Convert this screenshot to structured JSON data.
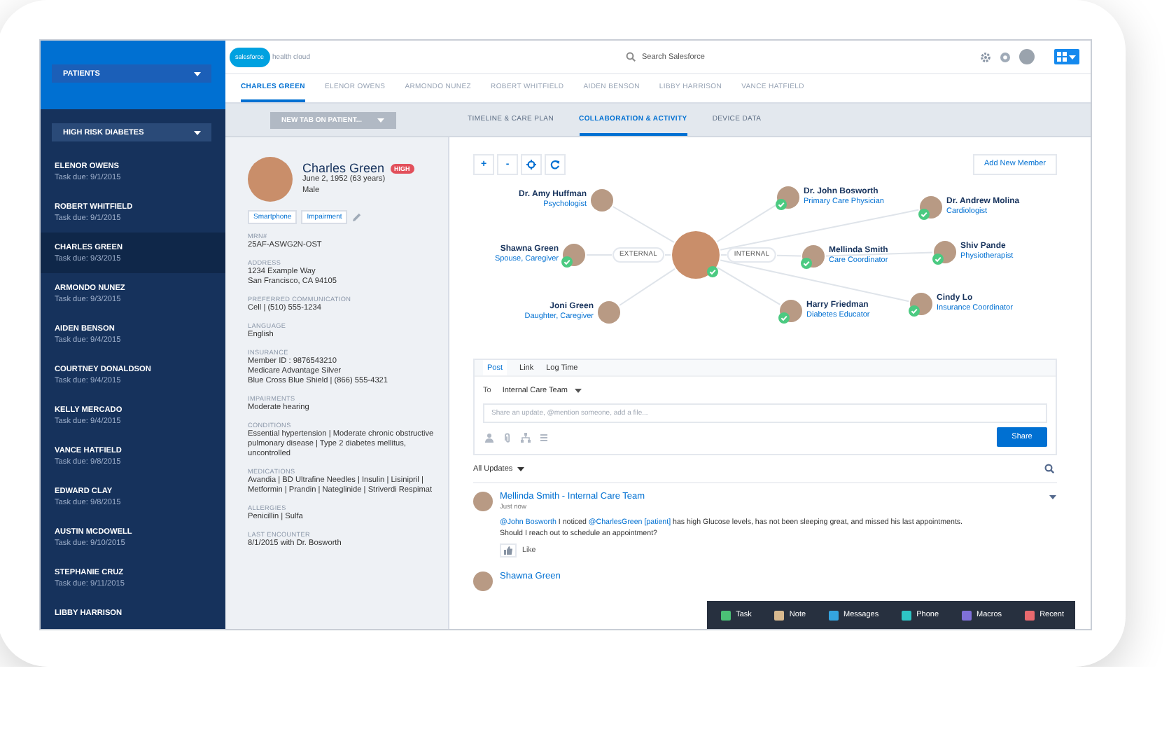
{
  "sidebar": {
    "list_selector": {
      "label": "PATIENTS"
    },
    "filter": {
      "label": "HIGH RISK DIABETES"
    },
    "patients": [
      {
        "name": "ELENOR OWENS",
        "task": "Task due: 9/1/2015",
        "selected": false
      },
      {
        "name": "ROBERT WHITFIELD",
        "task": "Task due: 9/1/2015",
        "selected": false
      },
      {
        "name": "CHARLES GREEN",
        "task": "Task due: 9/3/2015",
        "selected": true
      },
      {
        "name": "ARMONDO NUNEZ",
        "task": "Task due: 9/3/2015",
        "selected": false
      },
      {
        "name": "AIDEN BENSON",
        "task": "Task due: 9/4/2015",
        "selected": false
      },
      {
        "name": "COURTNEY DONALDSON",
        "task": "Task due: 9/4/2015",
        "selected": false
      },
      {
        "name": "KELLY MERCADO",
        "task": "Task due: 9/4/2015",
        "selected": false
      },
      {
        "name": "VANCE HATFIELD",
        "task": "Task due: 9/8/2015",
        "selected": false
      },
      {
        "name": "EDWARD CLAY",
        "task": "Task due: 9/8/2015",
        "selected": false
      },
      {
        "name": "AUSTIN MCDOWELL",
        "task": "Task due: 9/10/2015",
        "selected": false
      },
      {
        "name": "STEPHANIE CRUZ",
        "task": "Task due: 9/11/2015",
        "selected": false
      },
      {
        "name": "LIBBY HARRISON",
        "selected": false
      }
    ]
  },
  "header": {
    "logo": "salesforce",
    "app_name": "health cloud",
    "search": {
      "placeholder": "Search Salesforce"
    }
  },
  "patient_tabs": [
    {
      "label": "CHARLES GREEN",
      "selected": true
    },
    {
      "label": "ELENOR OWENS",
      "selected": false
    },
    {
      "label": "ARMONDO NUNEZ",
      "selected": false
    },
    {
      "label": "ROBERT WHITFIELD",
      "selected": false
    },
    {
      "label": "AIDEN BENSON",
      "selected": false
    },
    {
      "label": "LIBBY HARRISON",
      "selected": false
    },
    {
      "label": "VANCE HATFIELD",
      "selected": false
    }
  ],
  "new_tab": {
    "label": "NEW TAB ON PATIENT..."
  },
  "view_tabs": [
    {
      "label": "TIMELINE & CARE PLAN",
      "selected": false
    },
    {
      "label": "COLLABORATION & ACTIVITY",
      "selected": true
    },
    {
      "label": "DEVICE DATA",
      "selected": false
    }
  ],
  "patient": {
    "name": "Charles Green",
    "risk": "HIGH",
    "birth": "June 2, 1952 (63 years)",
    "gender": "Male",
    "tags": [
      "Smartphone",
      "Impairment"
    ],
    "fields": [
      {
        "label": "MRN#",
        "lines": [
          "25AF-ASWG2N-OST"
        ]
      },
      {
        "label": "ADDRESS",
        "lines": [
          "1234 Example Way",
          "San Francisco, CA 94105"
        ]
      },
      {
        "label": "PREFERRED COMMUNICATION",
        "lines": [
          "Cell | (510) 555-1234"
        ]
      },
      {
        "label": "LANGUAGE",
        "lines": [
          "English"
        ]
      },
      {
        "label": "INSURANCE",
        "lines": [
          "Member ID : 9876543210",
          "Medicare Advantage Silver",
          "Blue Cross Blue Shield | (866) 555-4321"
        ]
      },
      {
        "label": "IMPAIRMENTS",
        "lines": [
          "Moderate hearing"
        ]
      },
      {
        "label": "CONDITIONS",
        "lines": [
          "Essential hypertension | Moderate chronic obstructive pulmonary disease | Type 2 diabetes mellitus, uncontrolled"
        ]
      },
      {
        "label": "MEDICATIONS",
        "lines": [
          "Avandia | BD Ultrafine Needles | Insulin | Lisinipril | Metformin | Prandin | Nateglinide | Striverdi Respimat"
        ]
      },
      {
        "label": "ALLERGIES",
        "lines": [
          "Penicillin | Sulfa"
        ]
      },
      {
        "label": "LAST ENCOUNTER",
        "lines": [
          "8/1/2015 with Dr. Bosworth"
        ]
      }
    ]
  },
  "care_team": {
    "zoom_buttons": [
      "+",
      "-"
    ],
    "add_member": "Add New Member",
    "patient_verified": true,
    "groups": [
      {
        "label": "EXTERNAL",
        "members": [
          {
            "name": "Dr. Amy Huffman",
            "role": "Psychologist",
            "verified": false
          },
          {
            "name": "Shawna Green",
            "role": "Spouse, Caregiver",
            "verified": true
          },
          {
            "name": "Joni Green",
            "role": "Daughter, Caregiver",
            "verified": false
          }
        ]
      },
      {
        "label": "INTERNAL",
        "members": [
          {
            "name": "Dr. John Bosworth",
            "role": "Primary Care Physician",
            "verified": true
          },
          {
            "name": "Dr. Andrew Molina",
            "role": "Cardiologist",
            "verified": true
          },
          {
            "name": "Mellinda Smith",
            "role": "Care Coordinator",
            "verified": true
          },
          {
            "name": "Shiv Pande",
            "role": "Physiotherapist",
            "verified": true
          },
          {
            "name": "Harry Friedman",
            "role": "Diabetes Educator",
            "verified": true
          },
          {
            "name": "Cindy Lo",
            "role": "Insurance Coordinator",
            "verified": true
          }
        ]
      }
    ]
  },
  "composer": {
    "tabs": [
      {
        "label": "Post",
        "selected": true
      },
      {
        "label": "Link",
        "selected": false
      },
      {
        "label": "Log Time",
        "selected": false
      }
    ],
    "to_label": "To",
    "audience": "Internal Care Team",
    "placeholder": "Share an update, @mention someone, add a file...",
    "share": "Share"
  },
  "feed": {
    "filter": "All Updates",
    "posts": [
      {
        "author": "Mellinda Smith - Internal Care Team",
        "time": "Just now",
        "like": "Like",
        "body": [
          {
            "kind": "mention",
            "text": "@John Bosworth"
          },
          {
            "kind": "text",
            "text": " I noticed "
          },
          {
            "kind": "mention",
            "text": "@CharlesGreen [patient]"
          },
          {
            "kind": "text",
            "text": " has high Glucose levels, has not been sleeping great, and missed his last appointments.\nShould I reach out to schedule an appointment?"
          }
        ]
      },
      {
        "author": "Shawna Green"
      }
    ]
  },
  "utility_bar": [
    {
      "label": "Task",
      "color": "#4bc076"
    },
    {
      "label": "Note",
      "color": "#d8b98f"
    },
    {
      "label": "Messages",
      "color": "#34a4e0"
    },
    {
      "label": "Phone",
      "color": "#2ec4c4"
    },
    {
      "label": "Macros",
      "color": "#7f70d9"
    },
    {
      "label": "Recent",
      "color": "#e9696e"
    }
  ]
}
